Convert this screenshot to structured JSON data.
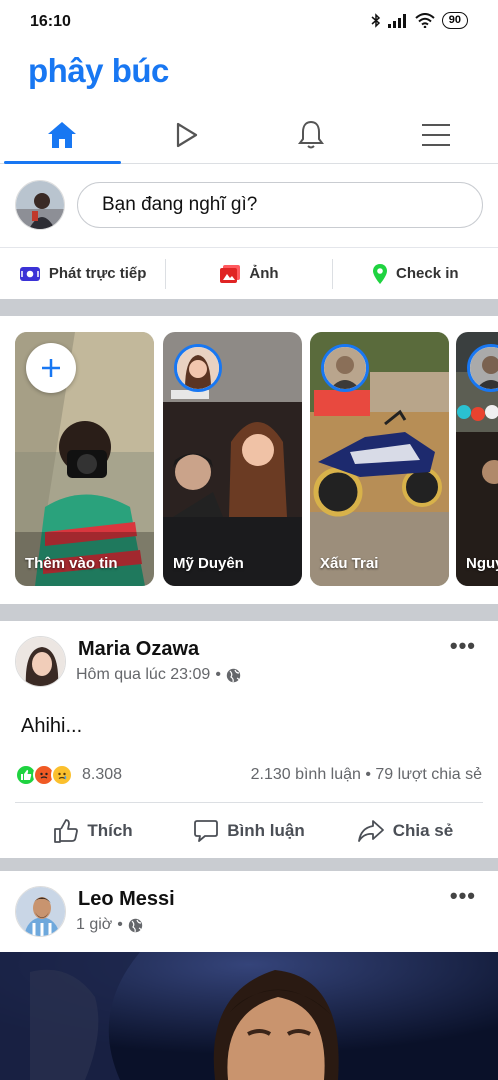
{
  "status": {
    "time": "16:10",
    "battery": "90"
  },
  "brand": {
    "title": "phây búc",
    "color": "#1877f2"
  },
  "nav": {
    "tabs": [
      {
        "name": "home-icon",
        "active": true
      },
      {
        "name": "watch-icon",
        "active": false
      },
      {
        "name": "bell-icon",
        "active": false
      },
      {
        "name": "menu-icon",
        "active": false
      }
    ]
  },
  "composer": {
    "placeholder": "Bạn đang nghĩ gì?"
  },
  "create_actions": {
    "live": "Phát trực tiếp",
    "photo": "Ảnh",
    "checkin": "Check in"
  },
  "stories": [
    {
      "label": "Thêm vào tin",
      "type": "add"
    },
    {
      "label": "Mỹ Duyên",
      "type": "story"
    },
    {
      "label": "Xấu Trai",
      "type": "story"
    },
    {
      "label": "Nguy",
      "type": "story"
    }
  ],
  "posts": [
    {
      "author": "Maria Ozawa",
      "time": "Hôm qua lúc 23:09",
      "text": "Ahihi...",
      "reaction_count": "8.308",
      "stats": "2.130 bình luận • 79 lượt chia sẻ",
      "actions": {
        "like": "Thích",
        "comment": "Bình luận",
        "share": "Chia sẻ"
      }
    },
    {
      "author": "Leo Messi",
      "time": "1 giờ"
    }
  ],
  "colors": {
    "accent": "#1877f2",
    "divider": "#c9ccd1",
    "muted": "#65676b"
  }
}
